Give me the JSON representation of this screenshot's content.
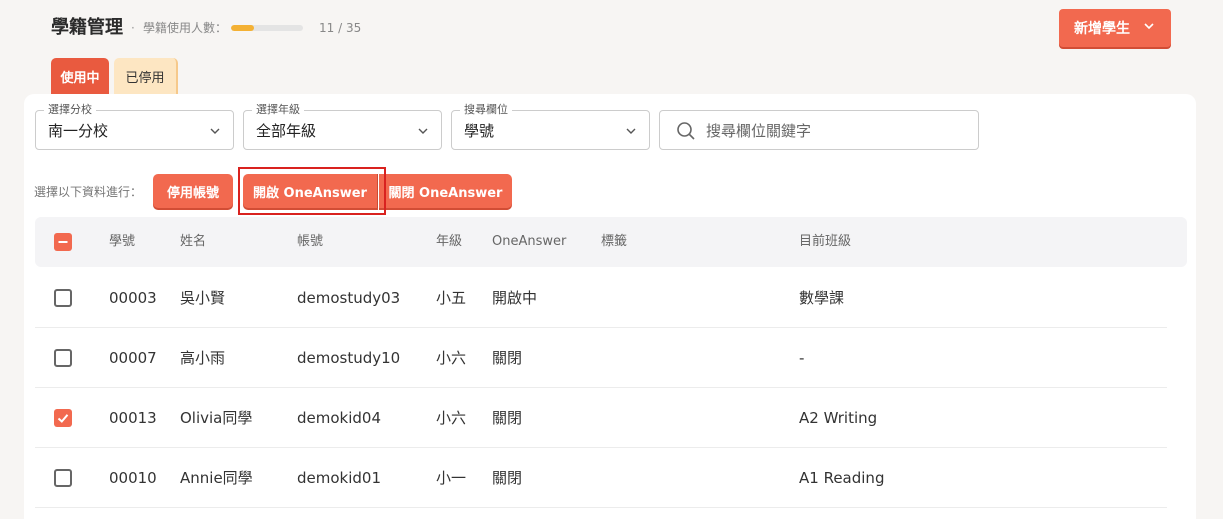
{
  "header": {
    "title": "學籍管理",
    "separator": "·",
    "usage_label": "學籍使用人數：",
    "usage_fraction": 0.314,
    "usage_count": "11 / 35",
    "new_button_label": "新增學生",
    "accent_color": "#f2694f"
  },
  "tabs": [
    {
      "label": "使用中",
      "active": true
    },
    {
      "label": "已停用",
      "active": false
    }
  ],
  "filters": {
    "school": {
      "legend": "選擇分校",
      "value": "南一分校"
    },
    "grade": {
      "legend": "選擇年級",
      "value": "全部年級"
    },
    "column": {
      "legend": "搜尋欄位",
      "value": "學號"
    },
    "search_placeholder": "搜尋欄位關鍵字"
  },
  "actions": {
    "label": "選擇以下資料進行：",
    "disable": "停用帳號",
    "open": "開啟 OneAnswer",
    "close": "關閉 OneAnswer"
  },
  "table": {
    "columns": [
      "學號",
      "姓名",
      "帳號",
      "年級",
      "OneAnswer",
      "標籤",
      "目前班級"
    ],
    "header_checkbox": "indeterminate",
    "rows": [
      {
        "checked": false,
        "id": "00003",
        "name": "吳小賢",
        "account": "demostudy03",
        "grade": "小五",
        "oneanswer": "開啟中",
        "tag": "",
        "class": "數學課"
      },
      {
        "checked": false,
        "id": "00007",
        "name": "高小雨",
        "account": "demostudy10",
        "grade": "小六",
        "oneanswer": "關閉",
        "tag": "",
        "class": "-"
      },
      {
        "checked": true,
        "id": "00013",
        "name": "Olivia同學",
        "account": "demokid04",
        "grade": "小六",
        "oneanswer": "關閉",
        "tag": "",
        "class": "A2 Writing"
      },
      {
        "checked": false,
        "id": "00010",
        "name": "Annie同學",
        "account": "demokid01",
        "grade": "小一",
        "oneanswer": "關閉",
        "tag": "",
        "class": "A1 Reading"
      }
    ]
  }
}
